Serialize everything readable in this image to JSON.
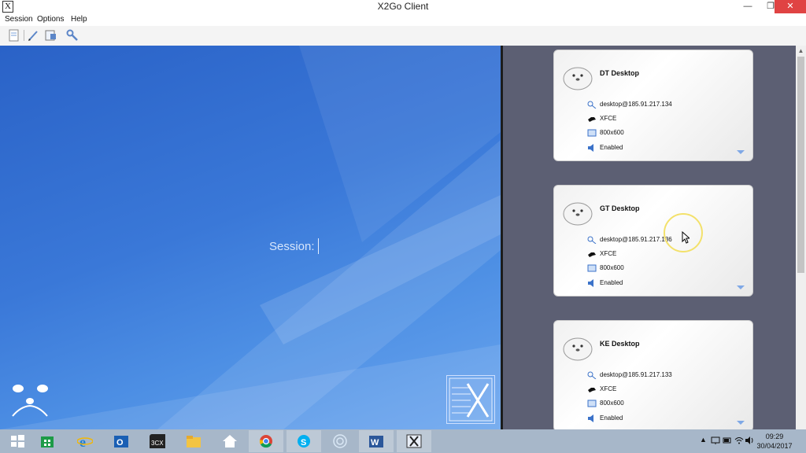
{
  "window": {
    "title": "X2Go Client",
    "app_icon": "X",
    "buttons": [
      "minimize-icon",
      "restore-icon",
      "close-icon"
    ]
  },
  "menu": [
    "Session",
    "Options",
    "Help"
  ],
  "toolbar_icons": [
    "new-session-icon",
    "edit-session-icon",
    "export-session-icon",
    "preferences-icon"
  ],
  "login": {
    "label": "Session:"
  },
  "sessions": [
    {
      "name": "DT Desktop",
      "host": "desktop@185.91.217.134",
      "desktop": "XFCE",
      "resolution": "800x600",
      "sound": "Enabled"
    },
    {
      "name": "GT Desktop",
      "host": "desktop@185.91.217.136",
      "desktop": "XFCE",
      "resolution": "800x600",
      "sound": "Enabled"
    },
    {
      "name": "KE Desktop",
      "host": "desktop@185.91.217.133",
      "desktop": "XFCE",
      "resolution": "800x600",
      "sound": "Enabled"
    }
  ],
  "taskbar": {
    "apps": [
      "windows-start-icon",
      "store-icon",
      "internet-explorer-icon",
      "outlook-icon",
      "3cx-icon",
      "file-explorer-icon",
      "home-icon",
      "chrome-icon",
      "skype-icon",
      "cortana-icon",
      "word-icon",
      "x2go-icon"
    ],
    "app_label_3cx": "3CX",
    "clock_time": "09:29",
    "clock_date": "30/04/2017"
  },
  "colors": {
    "close_button": "#e04343",
    "desktop_blue": "#3a78d8",
    "session_panel": "#5c5f73",
    "taskbar": "#a7b7c9"
  }
}
